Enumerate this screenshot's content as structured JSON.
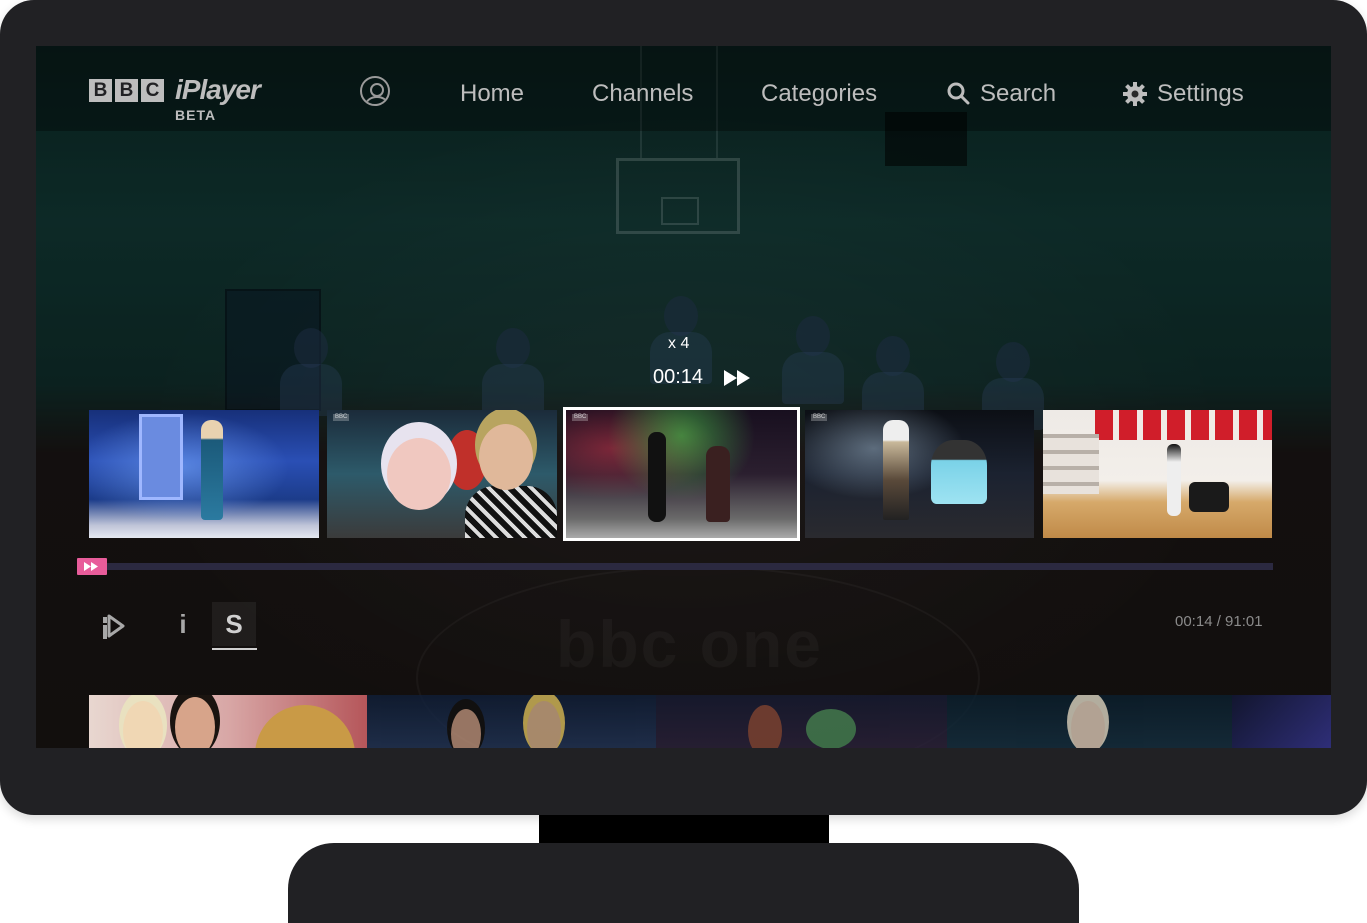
{
  "nav": {
    "logo_letters": [
      "B",
      "B",
      "C"
    ],
    "logo_word": "iPlayer",
    "logo_tag": "BETA",
    "items": {
      "home": "Home",
      "channels": "Channels",
      "categories": "Categories",
      "search": "Search",
      "settings": "Settings"
    },
    "icons": {
      "profile": "profile-icon",
      "search": "search-icon",
      "settings": "gear-icon"
    }
  },
  "player": {
    "speed": "x 4",
    "current_time": "00:14",
    "mode_icon": "fast-forward-icon",
    "time_display": "00:14 / 91:01",
    "progress_fraction": 0.014,
    "accent_color": "#e6237a",
    "controls": {
      "iplayer_icon": "iplayer-icon",
      "info": "i",
      "subtitles": "S"
    }
  },
  "thumbnails": {
    "count": 5,
    "selected_index": 2,
    "channel_badge": "BBC"
  },
  "background": {
    "watermark": "bbc one"
  }
}
